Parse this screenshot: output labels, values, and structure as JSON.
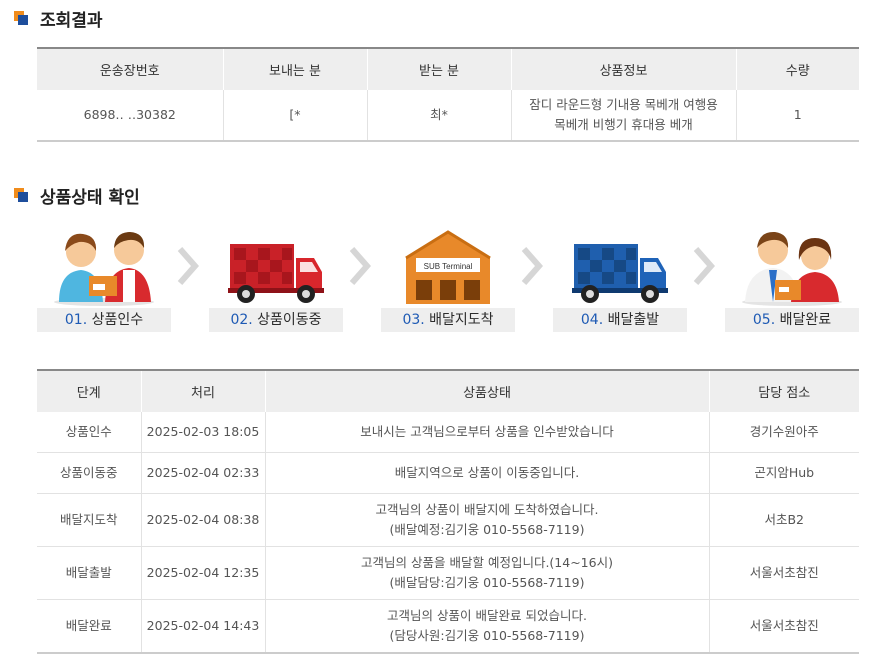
{
  "sections": {
    "result_title": "조회결과",
    "status_title": "상품상태 확인"
  },
  "result_table": {
    "headers": [
      "운송장번호",
      "보내는 분",
      "받는 분",
      "상품정보",
      "수량"
    ],
    "row": {
      "tracking_no": "6898‥ ‥30382",
      "sender": "[*",
      "receiver": "최*",
      "product_line1": "잠디 라운드형 기내용 목베개 여행용",
      "product_line2": "목베개 비행기 휴대용 베개",
      "quantity": "1"
    }
  },
  "steps": [
    {
      "num": "01.",
      "label": "상품인수",
      "icon": "handover-people-icon"
    },
    {
      "num": "02.",
      "label": "상품이동중",
      "icon": "red-truck-icon"
    },
    {
      "num": "03.",
      "label": "배달지도착",
      "icon": "sub-terminal-warehouse-icon",
      "sign": "SUB Terminal"
    },
    {
      "num": "04.",
      "label": "배달출발",
      "icon": "blue-truck-icon"
    },
    {
      "num": "05.",
      "label": "배달완료",
      "icon": "delivered-people-icon"
    }
  ],
  "status_table": {
    "headers": [
      "단계",
      "처리",
      "상품상태",
      "담당 점소"
    ],
    "rows": [
      {
        "stage": "상품인수",
        "time": "2025-02-03 18:05",
        "status1": "보내시는 고객님으로부터 상품을 인수받았습니다",
        "status2": "",
        "office": "경기수원아주"
      },
      {
        "stage": "상품이동중",
        "time": "2025-02-04 02:33",
        "status1": "배달지역으로 상품이 이동중입니다.",
        "status2": "",
        "office": "곤지암Hub"
      },
      {
        "stage": "배달지도착",
        "time": "2025-02-04 08:38",
        "status1": "고객님의 상품이 배달지에 도착하였습니다.",
        "status2": "(배달예정:김기웅 010-5568-7119)",
        "office": "서초B2"
      },
      {
        "stage": "배달출발",
        "time": "2025-02-04 12:35",
        "status1": "고객님의 상품을 배달할 예정입니다.(14~16시)",
        "status2": "(배달담당:김기웅 010-5568-7119)",
        "office": "서울서초참진"
      },
      {
        "stage": "배달완료",
        "time": "2025-02-04 14:43",
        "status1": "고객님의 상품이 배달완료 되었습니다.",
        "status2": "(담당사원:김기웅 010-5568-7119)",
        "office": "서울서초참진"
      }
    ]
  },
  "colors": {
    "accent_orange": "#f08c1c",
    "accent_blue": "#1e4e9c",
    "step_number": "#1e5ab4",
    "truck_red": "#d8262c",
    "truck_blue": "#1f63b8",
    "warehouse_orange": "#e8892a"
  }
}
